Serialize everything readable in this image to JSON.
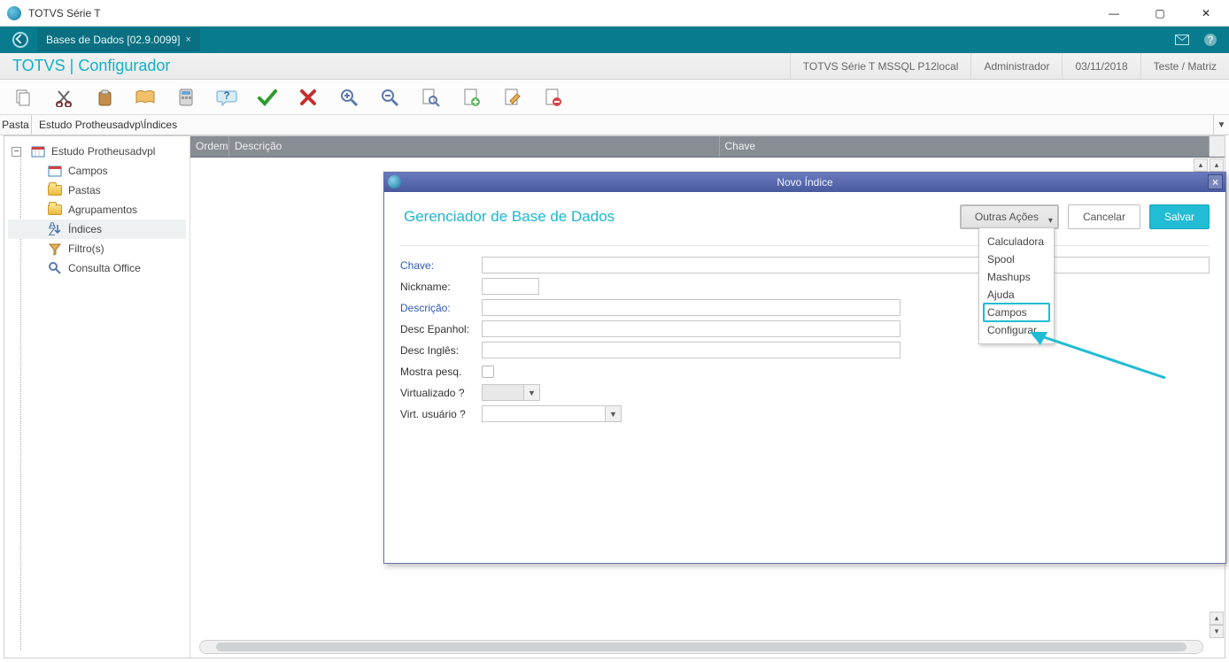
{
  "title": "TOTVS Série T",
  "tab": {
    "label": "Bases de Dados [02.9.0099]"
  },
  "banner": {
    "heading": "TOTVS | Configurador",
    "env": "TOTVS Série T  MSSQL P12local",
    "user": "Administrador",
    "date": "03/11/2018",
    "org": "Teste / Matriz"
  },
  "pathbar": {
    "label": "Pasta",
    "value": "Estudo Protheusadvp\\Índices"
  },
  "tree": {
    "root": "Estudo Protheusadvpl",
    "items": [
      {
        "label": "Campos"
      },
      {
        "label": "Pastas"
      },
      {
        "label": "Agrupamentos"
      },
      {
        "label": "Índices"
      },
      {
        "label": "Filtro(s)"
      },
      {
        "label": "Consulta Office"
      }
    ]
  },
  "grid": {
    "c1": "Ordem",
    "c2": "Descrição",
    "c3": "Chave"
  },
  "modal": {
    "title": "Novo Índice",
    "heading": "Gerenciador de Base de Dados",
    "actionsBtn": "Outras Ações",
    "cancel": "Cancelar",
    "save": "Salvar",
    "fields": {
      "chave": "Chave:",
      "nickname": "Nickname:",
      "descricao": "Descrição:",
      "desc_es": "Desc Epanhol:",
      "desc_en": "Desc Inglês:",
      "mostra": "Mostra pesq.",
      "virt": "Virtualizado ?",
      "virtUser": "Virt. usuário ?"
    }
  },
  "menu": {
    "items": [
      "Calculadora",
      "Spool",
      "Mashups",
      "Ajuda",
      "Campos",
      "Configurar"
    ],
    "highlightIndex": 4
  }
}
